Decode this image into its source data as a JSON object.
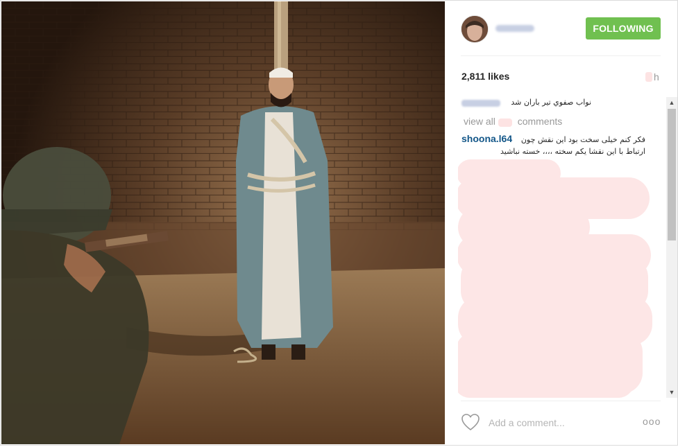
{
  "post": {
    "follow_label": "FOLLOWING",
    "likes": "2,811 likes",
    "time_unit": "h",
    "caption": "نواب صفوي تير باران شد",
    "view_all_prefix": "view all",
    "view_all_suffix": "comments",
    "comment": {
      "user": "shoona.l64",
      "text_line1": "فکر کنم خیلی سخت بود این نقش چون",
      "text_line2": "ارتباط با این نقشا یکم سخته ،،،، خسته نباشید"
    },
    "comment_placeholder": "Add a comment...",
    "more_label": "ooo"
  },
  "icons": {
    "heart": "heart-icon",
    "more": "more-options-icon",
    "scroll_up": "chevron-up-icon",
    "scroll_down": "chevron-down-icon"
  },
  "colors": {
    "follow_button": "#70c050",
    "username_link": "#125688",
    "muted_text": "#999999",
    "redaction": "#fde6e6"
  }
}
